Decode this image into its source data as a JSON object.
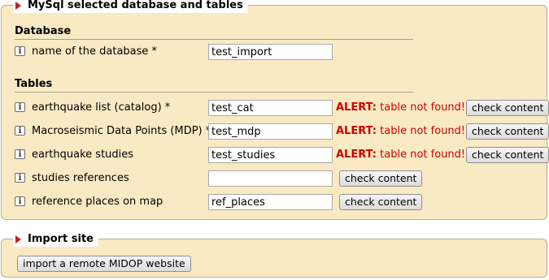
{
  "db_panel": {
    "title": "MySql selected database and tables",
    "database_heading": "Database",
    "database": {
      "info": "i",
      "label": "name of the database *",
      "value": "test_import"
    },
    "tables_heading": "Tables",
    "tables": [
      {
        "info": "i",
        "label": "earthquake list (catalog) *",
        "value": "test_cat",
        "alert_prefix": "ALERT:",
        "alert_text": "table not found!",
        "button": "check content"
      },
      {
        "info": "i",
        "label": "Macroseismic Data Points (MDP) *",
        "value": "test_mdp",
        "alert_prefix": "ALERT:",
        "alert_text": "table not found!",
        "button": "check content"
      },
      {
        "info": "i",
        "label": "earthquake studies",
        "value": "test_studies",
        "alert_prefix": "ALERT:",
        "alert_text": "table not found!",
        "button": "check content"
      },
      {
        "info": "i",
        "label": "studies references",
        "value": "",
        "button": "check content"
      },
      {
        "info": "i",
        "label": "reference places on map",
        "value": "ref_places",
        "button": "check content"
      }
    ]
  },
  "import_panel": {
    "title": "Import site",
    "button": "import a remote MIDOP website"
  },
  "colors": {
    "panel_bg": "#f9eac4",
    "alert": "#d00000",
    "arrow": "#b3261e"
  }
}
